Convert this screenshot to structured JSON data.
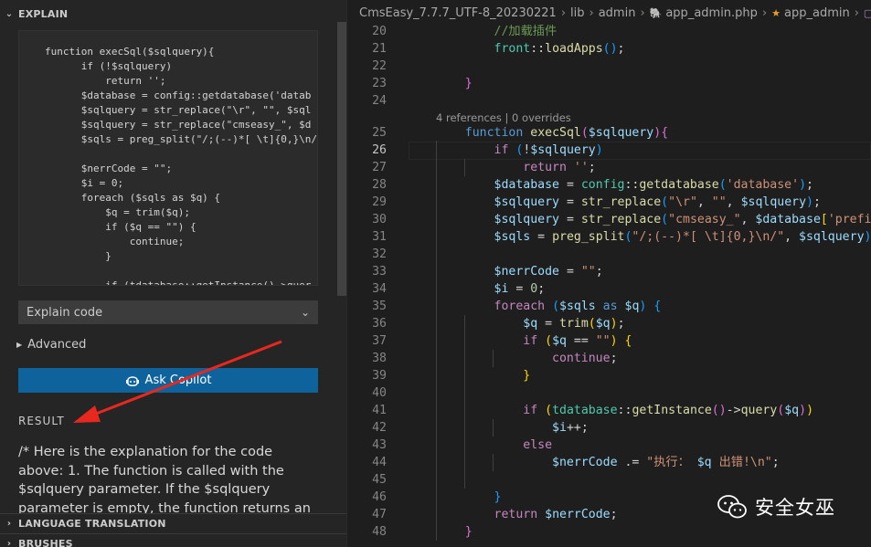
{
  "left_panel": {
    "explain_header": "EXPLAIN",
    "code_snippet": "function execSql($sqlquery){\n      if (!$sqlquery)\n          return '';\n      $database = config::getdatabase('datab\n      $sqlquery = str_replace(\"\\r\", \"\", $sql\n      $sqlquery = str_replace(\"cmseasy_\", $d\n      $sqls = preg_split(\"/;(--)*[ \\t]{0,}\\n/\n\n      $nerrCode = \"\";\n      $i = 0;\n      foreach ($sqls as $q) {\n          $q = trim($q);\n          if ($q == \"\") {\n              continue;\n          }\n\n          if (tdatabase::getInstance()->quer",
    "select_value": "Explain code",
    "advanced_label": "Advanced",
    "ask_button_label": "Ask Copilot",
    "result_label": "RESULT",
    "result_text": "/* Here is the explanation for the code above:\n1. The function is called with the $sqlquery parameter. If the $sqlquery parameter is empty, the function returns an empty string.",
    "sections": [
      "LANGUAGE TRANSLATION",
      "BRUSHES"
    ]
  },
  "breadcrumb": [
    "CmsEasy_7.7.7_UTF-8_20230221",
    "lib",
    "admin",
    "app_admin.php",
    "app_admin",
    "execSc"
  ],
  "codelens": "4 references | 0 overrides",
  "line_numbers": [
    "20",
    "21",
    "22",
    "23",
    "24",
    "25",
    "26",
    "27",
    "28",
    "29",
    "30",
    "31",
    "32",
    "33",
    "34",
    "35",
    "36",
    "37",
    "38",
    "39",
    "40",
    "41",
    "42",
    "43",
    "44",
    "45",
    "46",
    "47",
    "48"
  ],
  "active_line": "26",
  "watermark": "安全女巫",
  "colors": {
    "accent_button": "#0e639c",
    "arrow": "#e8281e"
  }
}
